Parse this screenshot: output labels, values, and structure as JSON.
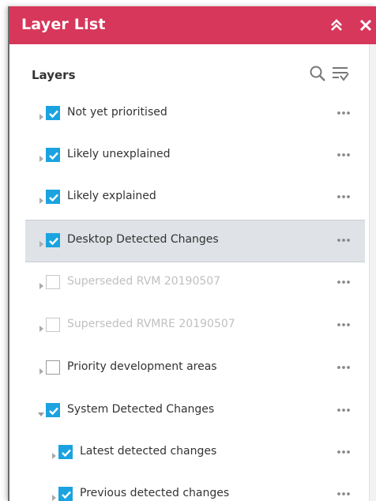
{
  "window": {
    "title": "Layer List",
    "accent_color": "#d6375a"
  },
  "panel": {
    "heading": "Layers"
  },
  "layers": [
    {
      "label": "Not yet prioritised",
      "checked": true,
      "enabled": true,
      "expanded": false,
      "level": 0
    },
    {
      "label": "Likely unexplained",
      "checked": true,
      "enabled": true,
      "expanded": false,
      "level": 0
    },
    {
      "label": "Likely explained",
      "checked": true,
      "enabled": true,
      "expanded": false,
      "level": 0
    },
    {
      "label": "Desktop Detected Changes",
      "checked": true,
      "enabled": true,
      "expanded": false,
      "level": 0,
      "selected": true
    },
    {
      "label": "Superseded RVM 20190507",
      "checked": false,
      "enabled": false,
      "expanded": false,
      "level": 0
    },
    {
      "label": "Superseded RVMRE 20190507",
      "checked": false,
      "enabled": false,
      "expanded": false,
      "level": 0
    },
    {
      "label": "Priority development areas",
      "checked": false,
      "enabled": true,
      "expanded": false,
      "level": 0
    },
    {
      "label": "System Detected Changes",
      "checked": true,
      "enabled": true,
      "expanded": true,
      "level": 0
    },
    {
      "label": "Latest detected changes",
      "checked": true,
      "enabled": true,
      "expanded": false,
      "level": 1
    },
    {
      "label": "Previous detected changes",
      "checked": true,
      "enabled": true,
      "expanded": false,
      "level": 1
    }
  ],
  "icons": {
    "collapse": "double-chevron-up-icon",
    "close": "close-icon",
    "search": "search-icon",
    "filter": "filter-icon",
    "more": "more-options-icon",
    "expand": "caret-right-icon",
    "expanded": "caret-down-icon",
    "check": "checkmark-icon"
  },
  "colors": {
    "checkbox_checked": "#1aa3e0",
    "selected_row": "#dfe2e6"
  }
}
